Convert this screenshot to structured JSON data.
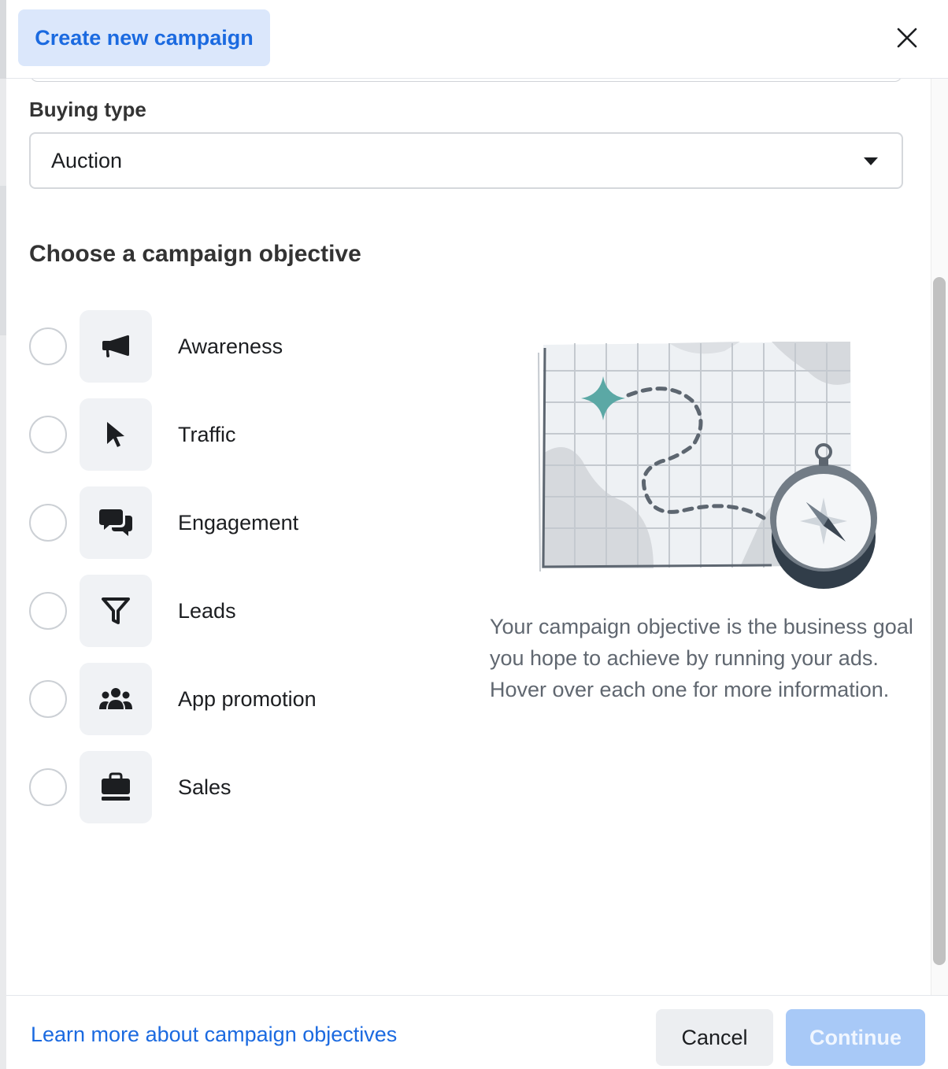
{
  "header": {
    "title": "Create new campaign",
    "close_icon": "close-icon"
  },
  "buying_type": {
    "label": "Buying type",
    "selected": "Auction"
  },
  "objective": {
    "title": "Choose a campaign objective",
    "items": [
      {
        "label": "Awareness",
        "icon": "megaphone-icon",
        "selected": false
      },
      {
        "label": "Traffic",
        "icon": "cursor-icon",
        "selected": false
      },
      {
        "label": "Engagement",
        "icon": "chat-bubbles-icon",
        "selected": false
      },
      {
        "label": "Leads",
        "icon": "funnel-icon",
        "selected": false
      },
      {
        "label": "App promotion",
        "icon": "people-icon",
        "selected": false
      },
      {
        "label": "Sales",
        "icon": "shopping-bag-icon",
        "selected": false
      }
    ],
    "description": "Your campaign objective is the business goal you hope to achieve by running your ads. Hover over each one for more information."
  },
  "footer": {
    "learn_more": "Learn more about campaign objectives",
    "cancel": "Cancel",
    "continue": "Continue"
  },
  "colors": {
    "accent": "#1b6ae0",
    "title_pill_bg": "#dbe7fb",
    "continue_disabled_bg": "#a8c9f7",
    "teal_star": "#5ba8a5"
  }
}
